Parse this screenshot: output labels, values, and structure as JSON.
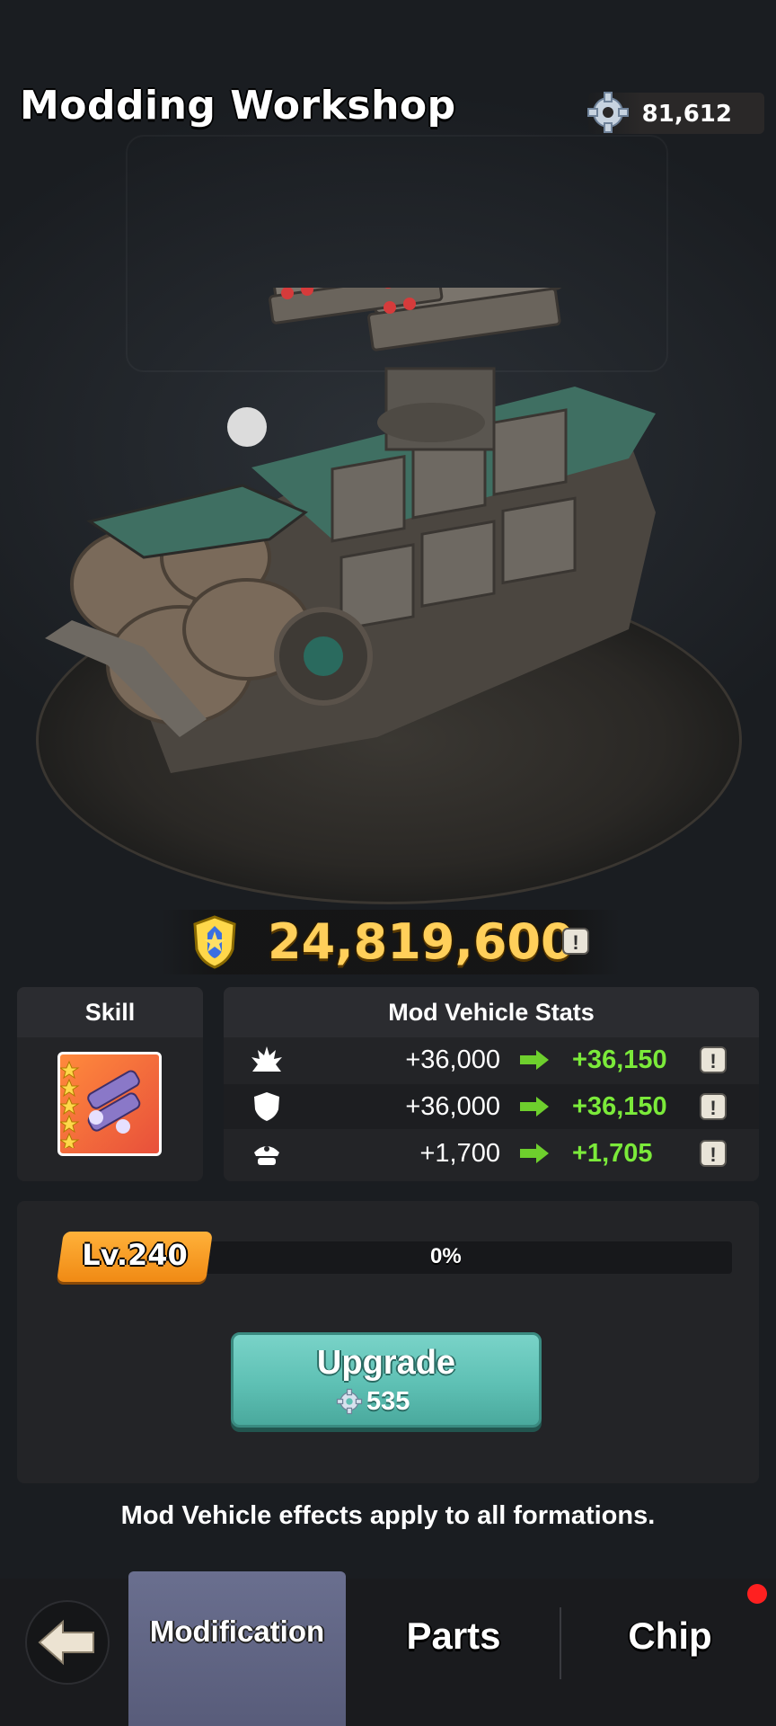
{
  "header": {
    "title": "Modding Workshop",
    "currency_icon": "gear-icon",
    "currency_amount": "81,612"
  },
  "power": {
    "icon": "shield-star-icon",
    "value": "24,819,600",
    "info": "!"
  },
  "skill": {
    "heading": "Skill",
    "icon": "rocket-launcher-skill-icon",
    "stars": 5
  },
  "stats": {
    "heading": "Mod Vehicle Stats",
    "rows": [
      {
        "icon": "attack-icon",
        "current": "+36,000",
        "next": "+36,150",
        "info": "!"
      },
      {
        "icon": "defense-icon",
        "current": "+36,000",
        "next": "+36,150",
        "info": "!"
      },
      {
        "icon": "hp-icon",
        "current": "+1,700",
        "next": "+1,705",
        "info": "!"
      }
    ],
    "colors": {
      "next_value": "#7bea3a",
      "arrow": "#6ecf2d"
    }
  },
  "level": {
    "label": "Lv.240",
    "progress_text": "0%",
    "progress": 0
  },
  "upgrade": {
    "label": "Upgrade",
    "cost": "535",
    "cost_icon": "gear-icon"
  },
  "note": "Mod Vehicle effects apply to all formations.",
  "nav": {
    "back_icon": "back-arrow-icon",
    "tabs": [
      {
        "label": "Modification",
        "active": true
      },
      {
        "label": "Parts",
        "active": false
      },
      {
        "label": "Chip",
        "active": false,
        "notification": true
      }
    ]
  }
}
